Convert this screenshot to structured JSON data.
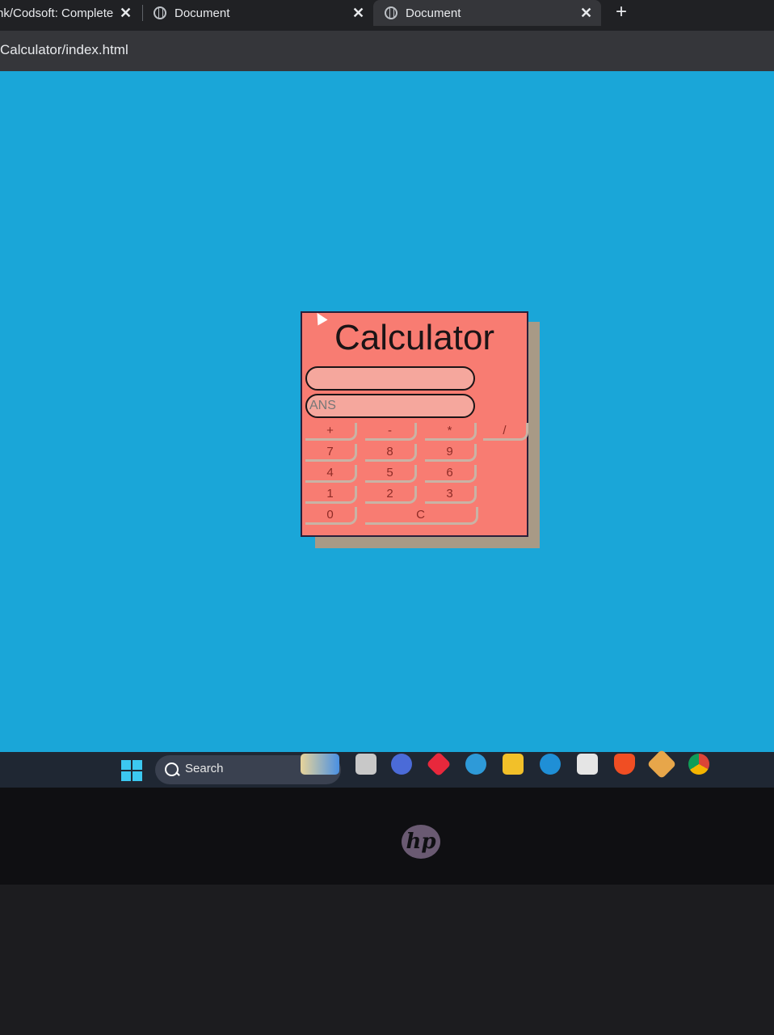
{
  "browser": {
    "tabs": [
      {
        "label": "nk/Codsoft: Complete",
        "close": "✕"
      },
      {
        "label": "Document",
        "close": "✕"
      },
      {
        "label": "Document",
        "close": "✕"
      }
    ],
    "new_tab": "+",
    "url": "Calculator/index.html"
  },
  "calculator": {
    "title": "Calculator",
    "input_value": "",
    "answer_placeholder": "ANS",
    "keys": {
      "plus": "+",
      "minus": "-",
      "multiply": "*",
      "divide": "/",
      "seven": "7",
      "eight": "8",
      "nine": "9",
      "four": "4",
      "five": "5",
      "six": "6",
      "one": "1",
      "two": "2",
      "three": "3",
      "zero": "0",
      "clear": "C"
    },
    "colors": {
      "panel": "#f87c72",
      "page_background": "#1aa6d8"
    }
  },
  "taskbar": {
    "search_label": "Search",
    "icons": [
      "windows-start-icon",
      "widgets-icon",
      "task-view-icon",
      "meet-icon",
      "app-diamond-icon",
      "help-icon",
      "file-explorer-icon",
      "edge-icon",
      "store-icon",
      "brave-icon",
      "app-tools-icon",
      "chrome-icon"
    ]
  },
  "device": {
    "logo": "hp"
  }
}
